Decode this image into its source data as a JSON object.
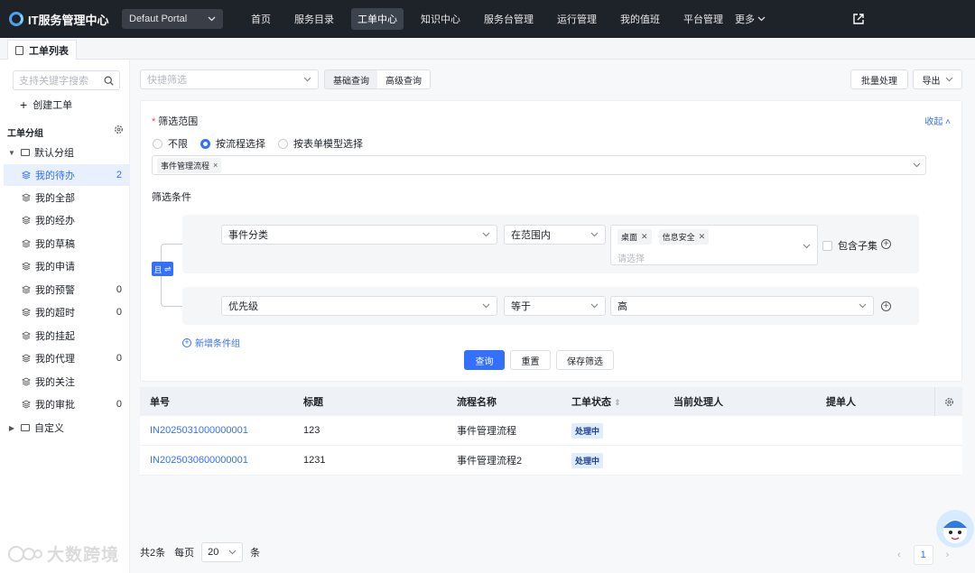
{
  "app": {
    "title": "IT服务管理中心",
    "portal": "Defaut Portal"
  },
  "nav": {
    "items": [
      "首页",
      "服务目录",
      "工单中心",
      "知识中心",
      "服务台管理",
      "运行管理",
      "我的值班",
      "平台管理"
    ],
    "active_index": 2,
    "more": "更多"
  },
  "page_tab": {
    "label": "工单列表"
  },
  "sidebar": {
    "search_placeholder": "支持关键字搜索",
    "create": "创建工单",
    "group_title": "工单分组",
    "default_group": "默认分组",
    "items": [
      {
        "label": "我的待办",
        "count": "2",
        "selected": true
      },
      {
        "label": "我的全部",
        "count": ""
      },
      {
        "label": "我的经办",
        "count": ""
      },
      {
        "label": "我的草稿",
        "count": ""
      },
      {
        "label": "我的申请",
        "count": ""
      },
      {
        "label": "我的预警",
        "count": "0"
      },
      {
        "label": "我的超时",
        "count": "0"
      },
      {
        "label": "我的挂起",
        "count": ""
      },
      {
        "label": "我的代理",
        "count": "0"
      },
      {
        "label": "我的关注",
        "count": ""
      },
      {
        "label": "我的审批",
        "count": "0"
      }
    ],
    "custom_group": "自定义"
  },
  "toolbar": {
    "quick_filter_placeholder": "快捷筛选",
    "basic_query": "基础查询",
    "advanced_query": "高级查询",
    "batch": "批量处理",
    "export": "导出"
  },
  "filter": {
    "scope_title": "筛选范围",
    "collapse": "收起",
    "radios": [
      "不限",
      "按流程选择",
      "按表单模型选择"
    ],
    "radio_selected": 1,
    "flow_tag": "事件管理流程",
    "conditions_title": "筛选条件",
    "and_label": "且",
    "cond1": {
      "field": "事件分类",
      "op": "在范围内",
      "tags": [
        "桌面",
        "信息安全"
      ],
      "placeholder": "请选择",
      "include_children": "包含子集"
    },
    "cond2": {
      "field": "优先级",
      "op": "等于",
      "value": "高"
    },
    "add_group": "新增条件组",
    "query": "查询",
    "reset": "重置",
    "save": "保存筛选"
  },
  "table": {
    "headers": [
      "单号",
      "标题",
      "流程名称",
      "工单状态",
      "当前处理人",
      "提单人"
    ],
    "rows": [
      {
        "id": "IN2025031000000001",
        "title": "123",
        "flow": "事件管理流程",
        "status": "处理中"
      },
      {
        "id": "IN2025030600000001",
        "title": "1231",
        "flow": "事件管理流程2",
        "status": "处理中"
      }
    ]
  },
  "pager": {
    "total": "共2条",
    "per_page_label": "每页",
    "per_page": "20",
    "unit": "条",
    "page": "1"
  },
  "watermark": {
    "text": "大数跨境"
  },
  "colors": {
    "accent": "#3370ff",
    "topbar": "#1e2229"
  }
}
